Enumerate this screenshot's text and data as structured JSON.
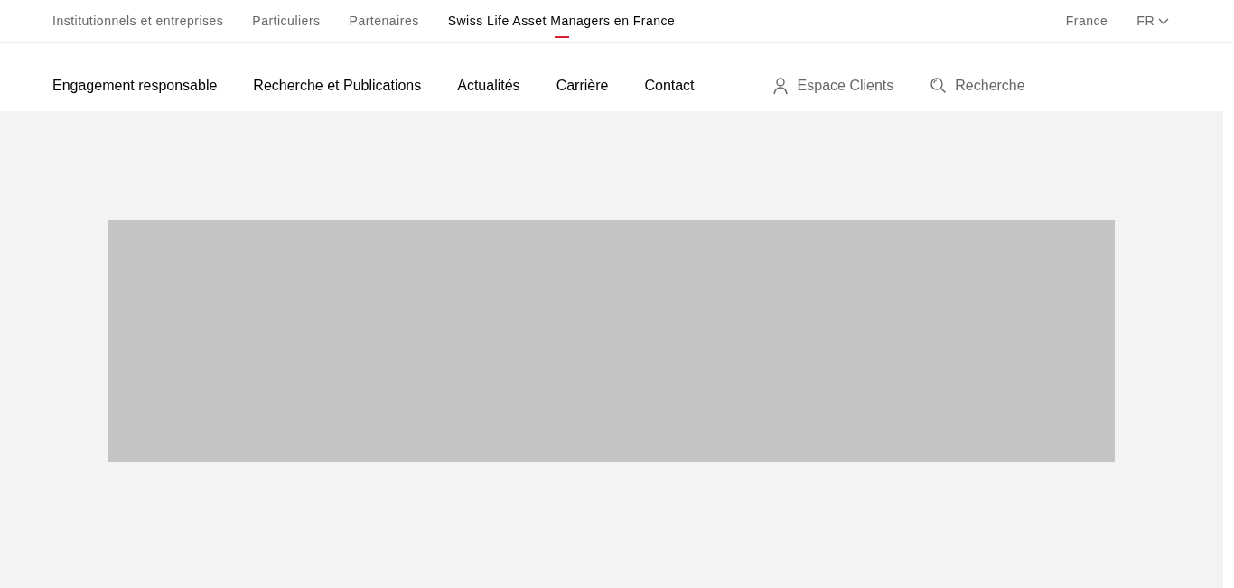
{
  "top_nav": [
    {
      "label": "Institutionnels et entreprises",
      "selected": false
    },
    {
      "label": "Particuliers",
      "selected": false
    },
    {
      "label": "Partenaires",
      "selected": false
    },
    {
      "label": "Swiss Life Asset Managers en France",
      "selected": true
    }
  ],
  "country": "France",
  "language": "FR",
  "main_nav": [
    "Engagement responsable",
    "Recherche et Publications",
    "Actualités",
    "Carrière",
    "Contact"
  ],
  "utilities": [
    {
      "kind": "account",
      "label": "Espace Clients"
    },
    {
      "kind": "search",
      "label": "Recherche"
    }
  ],
  "hero": {
    "kind": "placeholder"
  }
}
